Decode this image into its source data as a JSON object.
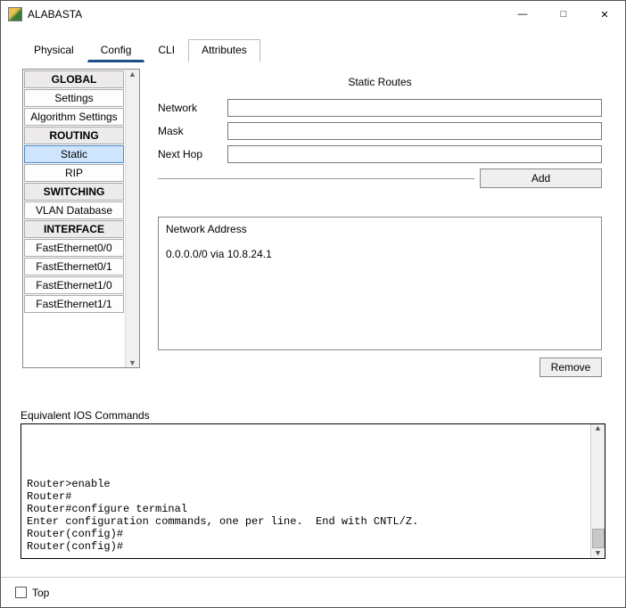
{
  "window": {
    "title": "ALABASTA"
  },
  "tabs": {
    "physical": "Physical",
    "config": "Config",
    "cli": "CLI",
    "attributes": "Attributes"
  },
  "sidebar": {
    "sections": [
      {
        "header": "GLOBAL",
        "items": [
          "Settings",
          "Algorithm Settings"
        ]
      },
      {
        "header": "ROUTING",
        "items": [
          "Static",
          "RIP"
        ]
      },
      {
        "header": "SWITCHING",
        "items": [
          "VLAN Database"
        ]
      },
      {
        "header": "INTERFACE",
        "items": [
          "FastEthernet0/0",
          "FastEthernet0/1",
          "FastEthernet1/0",
          "FastEthernet1/1"
        ]
      }
    ],
    "selected": "Static"
  },
  "panel": {
    "title": "Static Routes",
    "labels": {
      "network": "Network",
      "mask": "Mask",
      "nexthop": "Next Hop"
    },
    "values": {
      "network": "",
      "mask": "",
      "nexthop": ""
    },
    "buttons": {
      "add": "Add",
      "remove": "Remove"
    },
    "routes_header": "Network Address",
    "routes": [
      "0.0.0.0/0 via 10.8.24.1"
    ]
  },
  "ios": {
    "label": "Equivalent IOS Commands",
    "text": "Router>enable\nRouter#\nRouter#configure terminal\nEnter configuration commands, one per line.  End with CNTL/Z.\nRouter(config)#\nRouter(config)#"
  },
  "footer": {
    "top_label": "Top",
    "top_checked": false
  }
}
